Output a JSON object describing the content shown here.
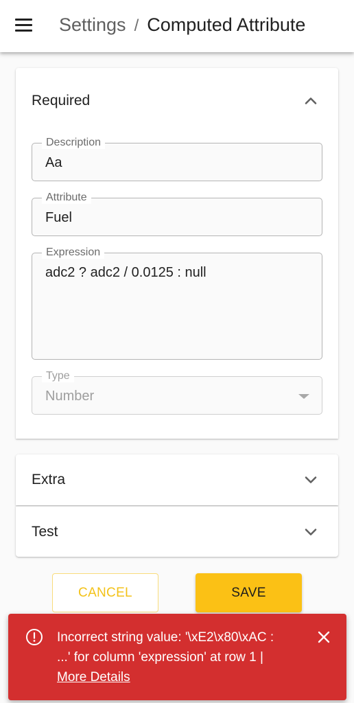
{
  "header": {
    "menu_icon": "hamburger-menu-icon",
    "breadcrumb_parent": "Settings",
    "breadcrumb_separator": "/",
    "breadcrumb_current": "Computed Attribute"
  },
  "required_section": {
    "title": "Required",
    "expanded": true,
    "toggle_icon": "chevron-up-icon",
    "fields": {
      "description": {
        "label": "Description",
        "value": "Aa"
      },
      "attribute": {
        "label": "Attribute",
        "value": "Fuel"
      },
      "expression": {
        "label": "Expression",
        "value": "adc2 ? adc2 / 0.0125 : null"
      },
      "type": {
        "label": "Type",
        "value": "Number",
        "disabled": true
      }
    }
  },
  "extra_section": {
    "title": "Extra",
    "expanded": false,
    "toggle_icon": "chevron-down-icon"
  },
  "test_section": {
    "title": "Test",
    "expanded": false,
    "toggle_icon": "chevron-down-icon"
  },
  "actions": {
    "cancel_label": "CANCEL",
    "save_label": "SAVE"
  },
  "error_snackbar": {
    "icon": "error-outline-icon",
    "line1": "Incorrect string value: '\\xE2\\x80\\xAC :",
    "line2": "...' for column 'expression' at row 1 |",
    "link_label": "More Details",
    "close_icon": "close-icon"
  },
  "colors": {
    "accent": "#fbc115",
    "error": "#d32f2f",
    "appbar": "#ffffff",
    "background": "#fafafa"
  }
}
